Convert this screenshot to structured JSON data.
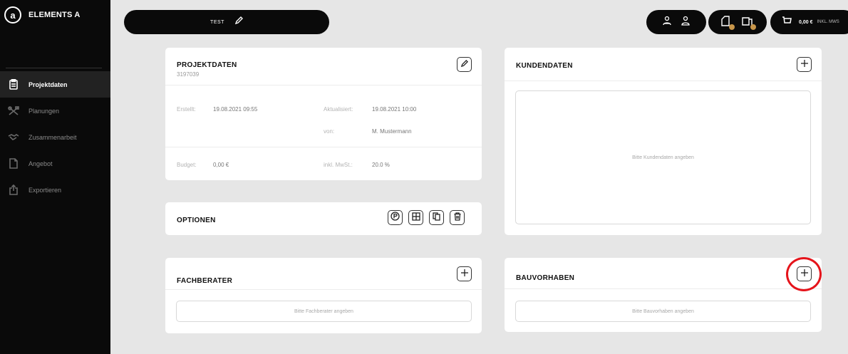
{
  "app": {
    "brand_name": "ELEMENTS A",
    "brand_letter": "a"
  },
  "sidebar": {
    "items": [
      {
        "label": "Projektdaten",
        "icon": "clipboard-icon",
        "active": true
      },
      {
        "label": "Planungen",
        "icon": "tools-icon",
        "active": false
      },
      {
        "label": "Zusammenarbeit",
        "icon": "handshake-icon",
        "active": false
      },
      {
        "label": "Angebot",
        "icon": "document-icon",
        "active": false
      },
      {
        "label": "Exportieren",
        "icon": "export-icon",
        "active": false
      }
    ]
  },
  "topbar": {
    "project_name": "TEST",
    "cart_amount": "0,00 €",
    "cart_tax": "INKL. MWS"
  },
  "projektdaten": {
    "title": "PROJEKTDATEN",
    "id": "3197039",
    "created_label": "Erstellt:",
    "created_value": "19.08.2021 09:55",
    "updated_label": "Aktualisiert:",
    "updated_value": "19.08.2021 10:00",
    "by_label": "von:",
    "by_value": "M. Mustermann",
    "budget_label": "Budget:",
    "budget_value": "0,00 €",
    "tax_label": "inkl. MwSt.:",
    "tax_value": "20.0 %"
  },
  "optionen": {
    "title": "OPTIONEN"
  },
  "fachberater": {
    "title": "FACHBERATER",
    "placeholder": "Bitte Fachberater angeben"
  },
  "kundendaten": {
    "title": "KUNDENDATEN",
    "placeholder": "Bitte Kundendaten angeben"
  },
  "bauvorhaben": {
    "title": "BAUVORHABEN",
    "placeholder": "Bitte Bauvorhaben angeben"
  },
  "colors": {
    "highlight": "#e5141b",
    "badge": "#c8964a",
    "sidebar_bg": "#0a0a0a"
  }
}
